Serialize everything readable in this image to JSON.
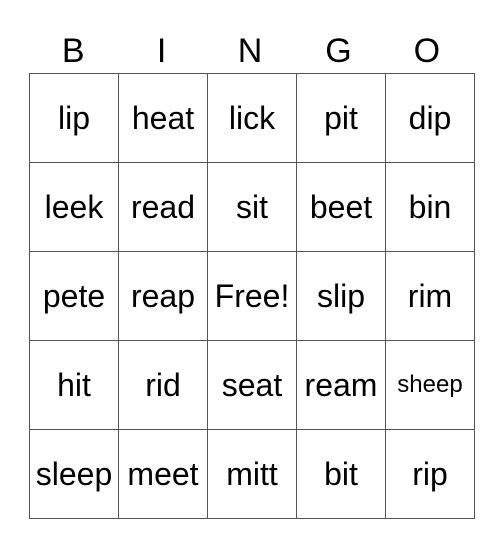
{
  "header": [
    "B",
    "I",
    "N",
    "G",
    "O"
  ],
  "rows": [
    [
      "lip",
      "heat",
      "lick",
      "pit",
      "dip"
    ],
    [
      "leek",
      "read",
      "sit",
      "beet",
      "bin"
    ],
    [
      "pete",
      "reap",
      "Free!",
      "slip",
      "rim"
    ],
    [
      "hit",
      "rid",
      "seat",
      "ream",
      "sheep"
    ],
    [
      "sleep",
      "meet",
      "mitt",
      "bit",
      "rip"
    ]
  ]
}
